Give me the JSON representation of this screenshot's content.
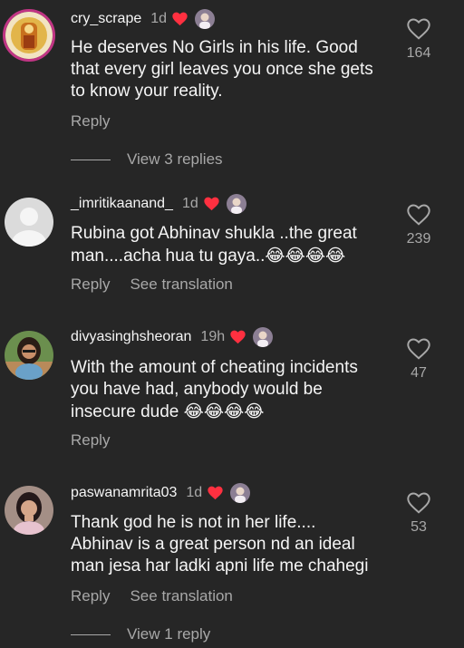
{
  "comments": [
    {
      "username": "cry_scrape",
      "time": "1d",
      "lines": [
        "He deserves No Girls in his life. Good",
        "that every girl leaves you once she gets",
        "to know your reality."
      ],
      "likes": "164",
      "reply_label": "Reply",
      "view_replies": "View 3 replies"
    },
    {
      "username": "_imritikaanand_",
      "time": "1d",
      "lines": [
        "Rubina got Abhinav shukla ..the great",
        "man....acha hua tu gaya.."
      ],
      "emoji": "😂😂😂😂",
      "likes": "239",
      "reply_label": "Reply",
      "translation_label": "See translation"
    },
    {
      "username": "divyasinghsheoran",
      "time": "19h",
      "lines": [
        "With the amount of cheating incidents",
        "you have had, anybody would be",
        "insecure dude"
      ],
      "emoji": "😂😂😂😂",
      "likes": "47",
      "reply_label": "Reply"
    },
    {
      "username": "paswanamrita03",
      "time": "1d",
      "lines": [
        "Thank god he is not in her life....",
        "Abhinav is a great person nd an ideal",
        "man jesa har ladki apni life me chahegi"
      ],
      "likes": "53",
      "reply_label": "Reply",
      "translation_label": "See translation",
      "view_replies": "View 1 reply"
    }
  ],
  "colors": {
    "background": "#262626",
    "primary_text": "#f5f5f5",
    "secondary_text": "#a8a8a8",
    "heart_red": "#ff3040"
  },
  "icons": {
    "like": "heart-outline-icon",
    "author_like": "heart-filled-icon"
  }
}
